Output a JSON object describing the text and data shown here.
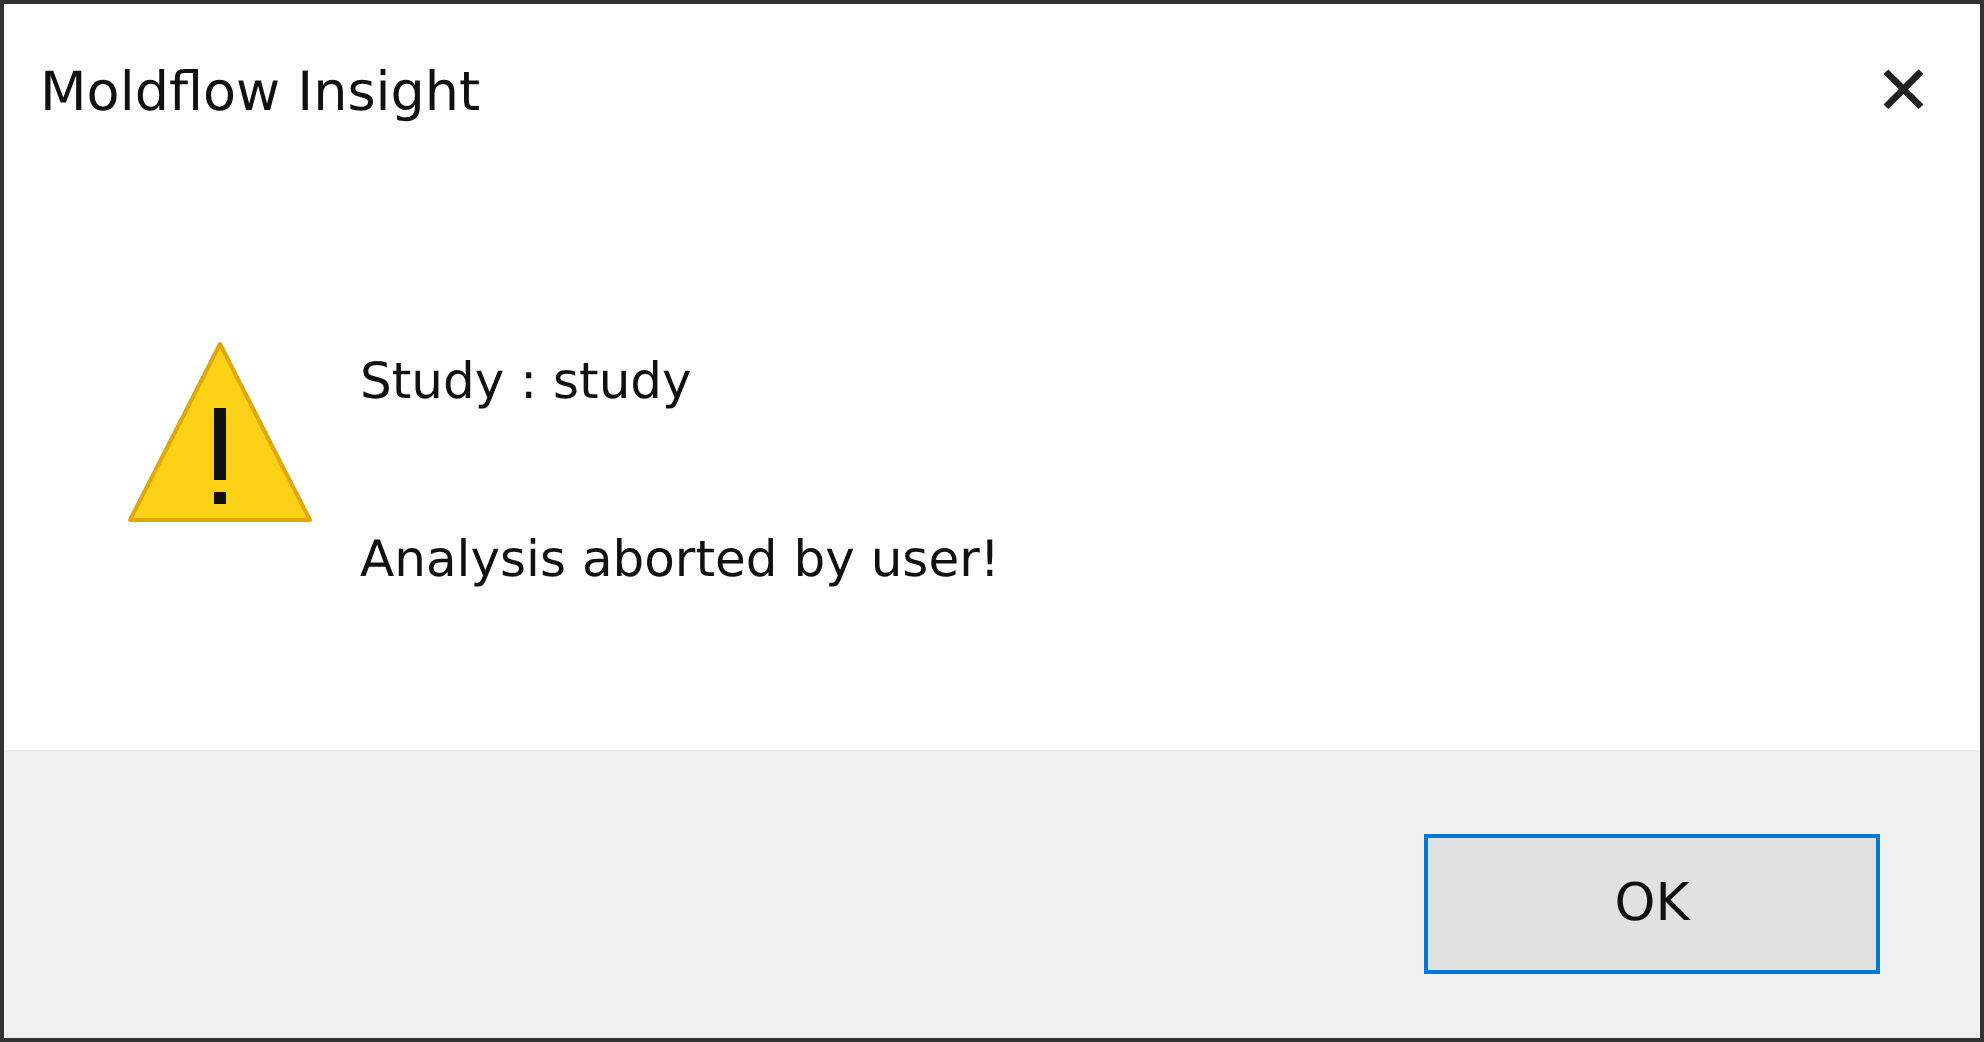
{
  "window": {
    "title": "Moldflow Insight",
    "close": "✕"
  },
  "message": {
    "lines": [
      "Study :  study",
      "Analysis aborted by user!"
    ]
  },
  "buttons": [
    {
      "label": "OK",
      "selected": true
    }
  ]
}
